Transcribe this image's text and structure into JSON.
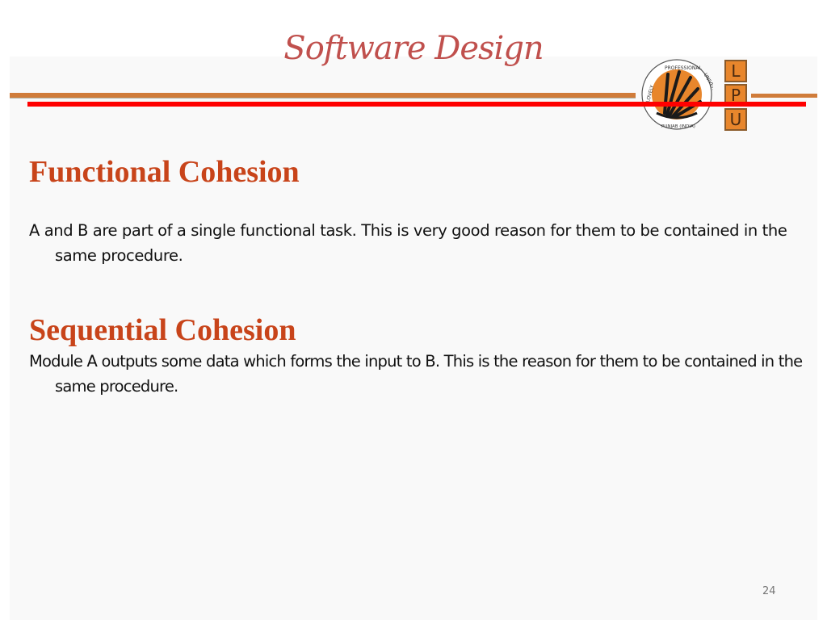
{
  "slide": {
    "title": "Software Design",
    "logo": {
      "circle_text_top": "PROFESSIONAL",
      "circle_text_left": "LOVELY",
      "circle_text_right": "UNIVERSITY",
      "circle_text_bottom": "PUNJAB (INDIA)",
      "letters": [
        "L",
        "P",
        "U"
      ],
      "colors": {
        "orange": "#e8862c",
        "dark": "#1a1a1a"
      }
    },
    "rules": {
      "orange": "#d07c3a",
      "red": "#ff0000"
    },
    "sections": [
      {
        "heading": "Functional Cohesion",
        "text": "A and B are part of a single functional task. This is very good reason for them to be contained in the same procedure."
      },
      {
        "heading": "Sequential Cohesion",
        "text": "Module A outputs some data which forms the input to B. This is the reason for them to be contained in the same procedure."
      }
    ],
    "heading_color": "#c8441a",
    "title_color": "#c0504d",
    "page_number": "24"
  }
}
